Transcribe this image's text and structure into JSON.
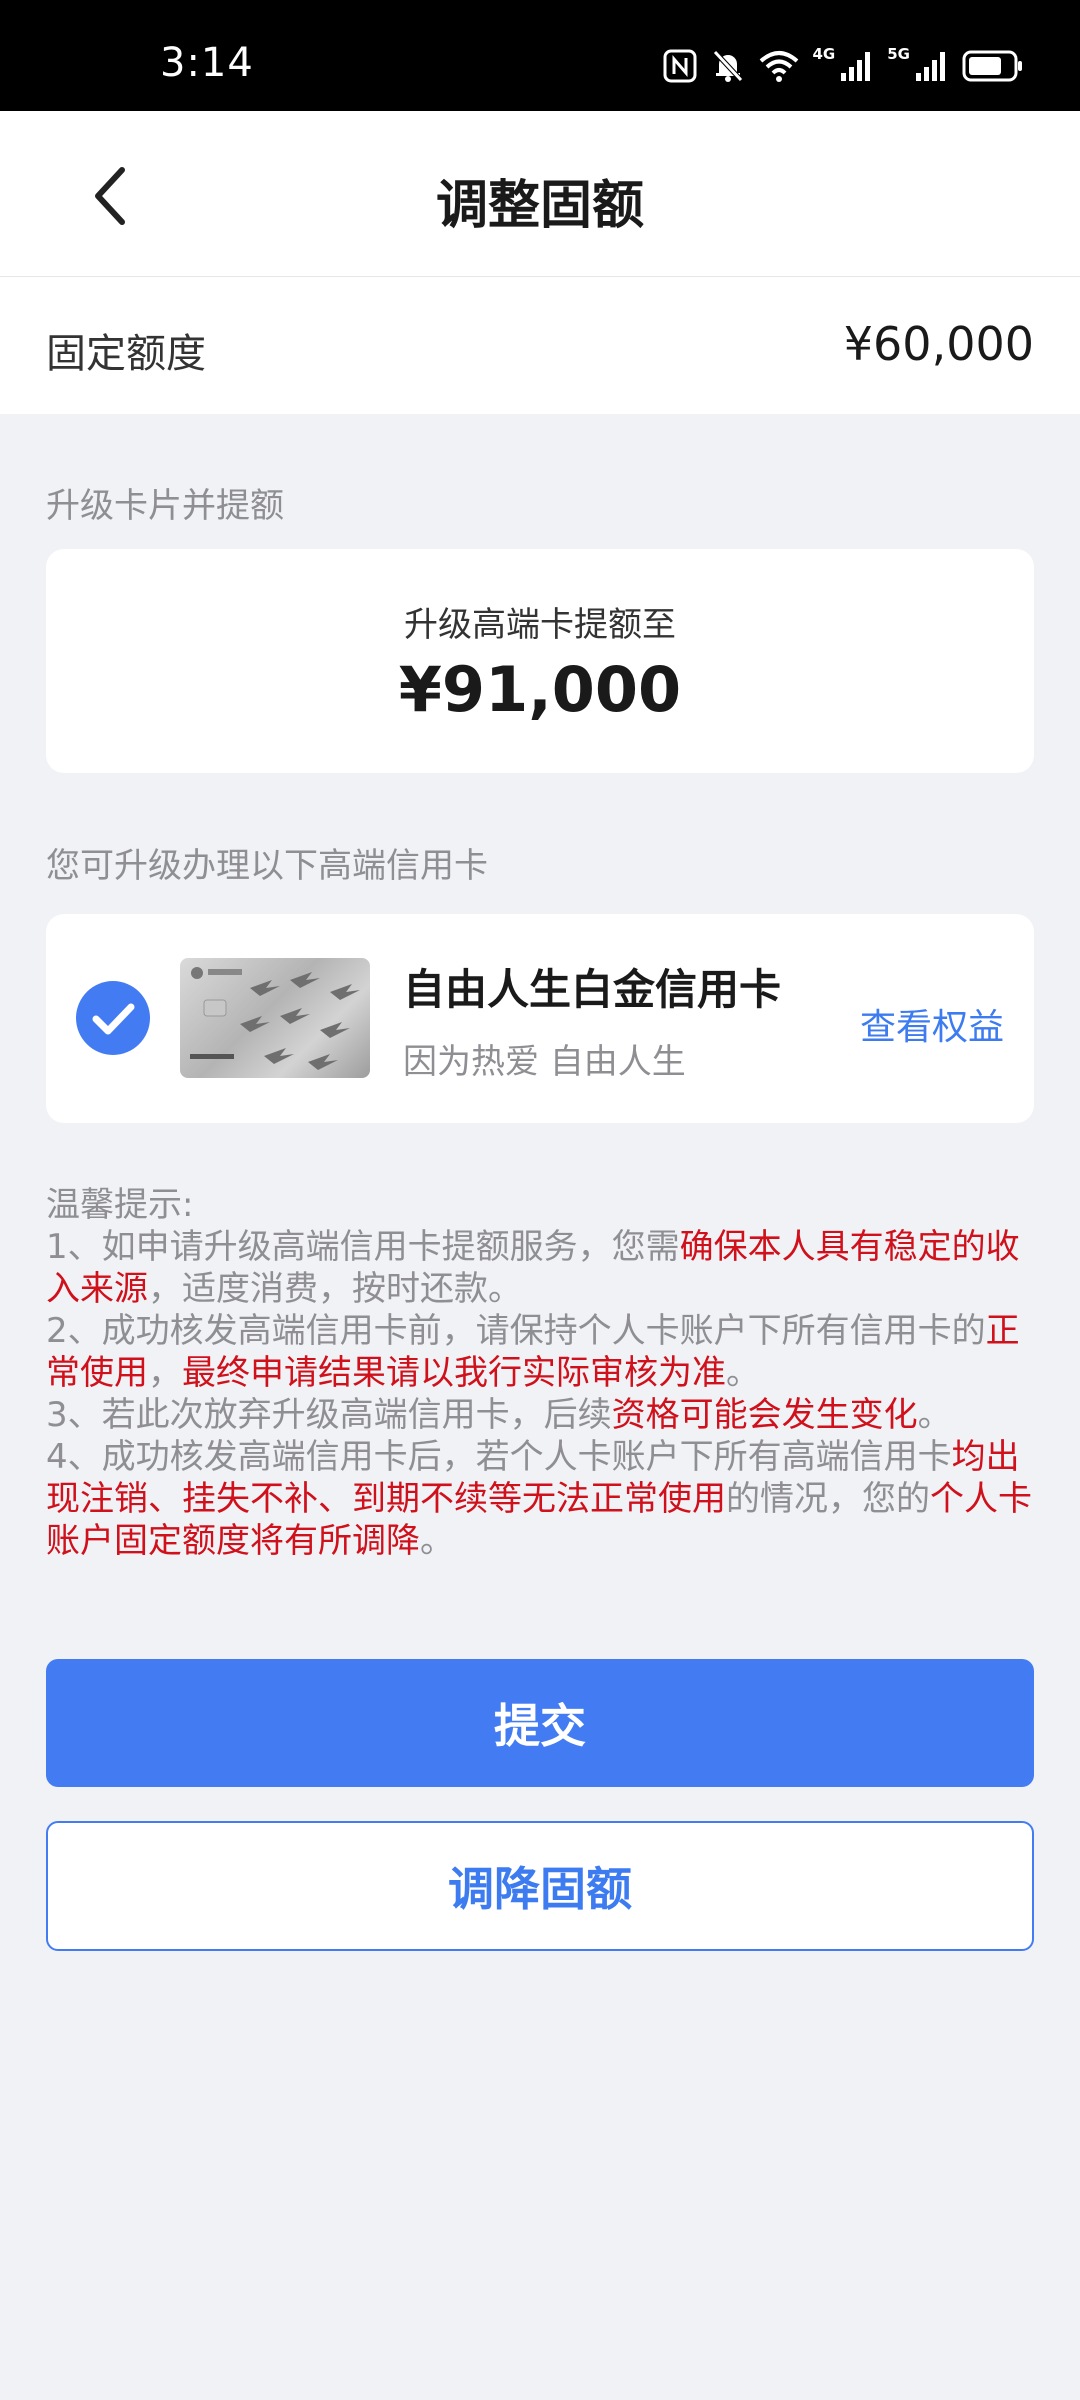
{
  "status_bar": {
    "time": "3:14",
    "net1": "4G",
    "net2": "5G",
    "icons": [
      "nfc-icon",
      "bell-mute-icon",
      "wifi-icon",
      "signal-icon",
      "signal-icon",
      "battery-icon"
    ]
  },
  "header": {
    "title": "调整固额",
    "back_icon": "chevron-left-icon"
  },
  "fixed_limit": {
    "label": "固定额度",
    "value": "¥60,000"
  },
  "upgrade_section": {
    "label": "升级卡片并提额",
    "subtitle": "升级高端卡提额至",
    "amount": "¥91,000"
  },
  "cards_section": {
    "label": "您可升级办理以下高端信用卡",
    "card": {
      "name": "自由人生白金信用卡",
      "slogan": "因为热爱 自由人生",
      "link": "查看权益",
      "selected": true
    }
  },
  "tips": {
    "title": "温馨提示:",
    "t1a": "1、如申请升级高端信用卡提额服务，您需",
    "t1b": "确保本人具有稳定的收入来源",
    "t1c": "，适度消费，按时还款。",
    "t2a": "2、成功核发高端信用卡前，请保持个人卡账户下所有信用卡的",
    "t2b": "正常使用",
    "t2c": "，",
    "t2d": "最终申请结果请以我行实际审核为准",
    "t2e": "。",
    "t3a": "3、若此次放弃升级高端信用卡，后续",
    "t3b": "资格可能会发生变化",
    "t3c": "。",
    "t4a": "4、成功核发高端信用卡后，若个人卡账户下所有高端信用卡",
    "t4b": "均出现注销、挂失不补、到期不续等无法正常使用",
    "t4c": "的情况，您的",
    "t4d": "个人卡账户固定额度将有所调降",
    "t4e": "。"
  },
  "buttons": {
    "submit": "提交",
    "lower": "调降固额"
  },
  "colors": {
    "primary": "#437cf2",
    "link": "#3d7bf0",
    "warning_red": "#d0101b",
    "page_bg": "#f0f2f6"
  }
}
